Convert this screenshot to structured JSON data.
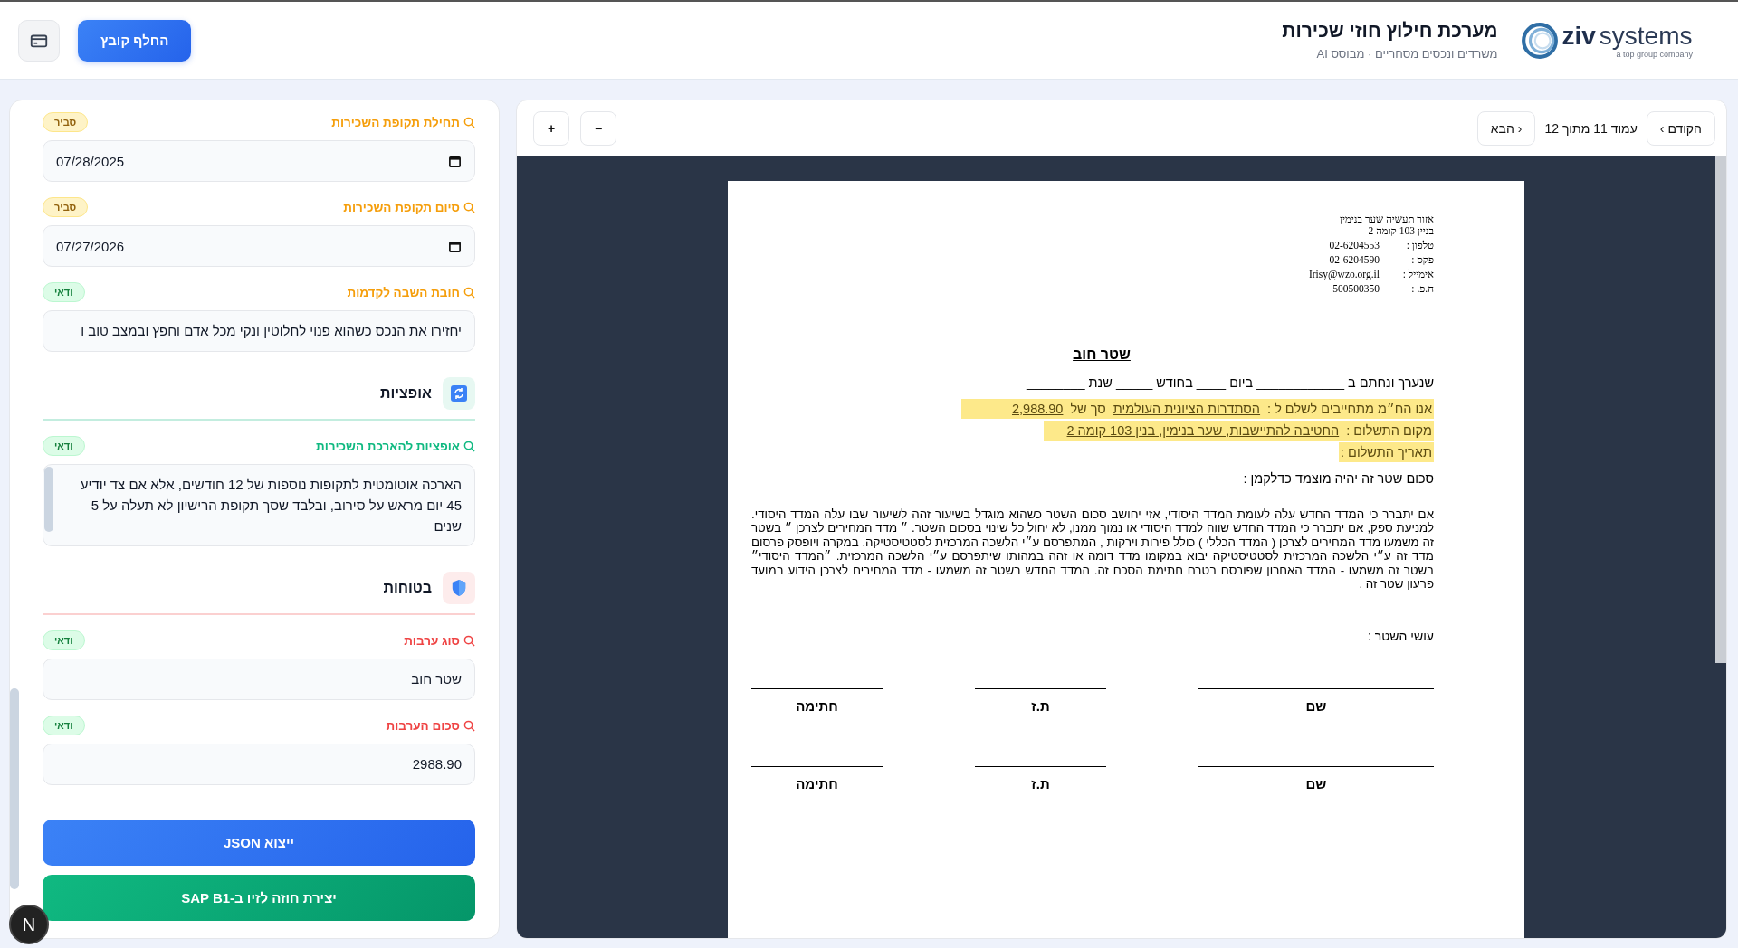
{
  "header": {
    "title": "מערכת חילוץ חוזי שכירות",
    "subtitle": "משרדים ונכסים מסחריים · מבוסס AI",
    "logo": {
      "word_bold": "ziv",
      "word": "systems",
      "tagline": "a top group company"
    },
    "replace_button": "החלף קובץ"
  },
  "form": {
    "sections": [
      {
        "color": "#f59e0b",
        "fields": [
          {
            "label": "תחילת תקופת השכירות",
            "badge": {
              "text": "סביר",
              "kind": "likely"
            },
            "kind": "date",
            "value": "07/28/2025"
          },
          {
            "label": "סיום תקופת השכירות",
            "badge": {
              "text": "סביר",
              "kind": "likely"
            },
            "kind": "date",
            "value": "07/27/2026"
          },
          {
            "label": "חובת השבה לקדמות",
            "badge": {
              "text": "ודאי",
              "kind": "certain"
            },
            "kind": "text",
            "value": "יחזירו את הנכס כשהוא פנוי לחלוטין ונקי מכל אדם וחפץ ובמצב טוב ו"
          }
        ]
      },
      {
        "title": "אופציות",
        "color": "#10b981",
        "fields": [
          {
            "label": "אופציות להארכת השכירות",
            "badge": {
              "text": "ודאי",
              "kind": "certain"
            },
            "kind": "textarea",
            "value": "הארכה אוטומטית לתקופות נוספות של 12 חודשים, אלא אם צד יודיע 45 יום מראש על סירוב, ובלבד שסך תקופת הרישיון לא תעלה על 5 שנים"
          }
        ]
      },
      {
        "title": "בטוחות",
        "color": "#ef4444",
        "fields": [
          {
            "label": "סוג ערבות",
            "badge": {
              "text": "ודאי",
              "kind": "certain"
            },
            "kind": "text",
            "value": "שטר חוב"
          },
          {
            "label": "סכום הערבות",
            "badge": {
              "text": "ודאי",
              "kind": "certain"
            },
            "kind": "text",
            "value": "2988.90"
          }
        ]
      }
    ],
    "export_button": "ייצוא JSON",
    "sap_button": "יצירת חוזה לזיו ב-SAP B1"
  },
  "dev_badge": "N",
  "viewer": {
    "prev": "‹ הקודם",
    "page_info": "עמוד 11 מתוך 12",
    "next": "הבא ›",
    "zoom_in": "+",
    "zoom_out": "−"
  },
  "document": {
    "address": [
      "אזור תעשיה שער בנימין",
      "בניין 103 קומה 2"
    ],
    "contacts": [
      {
        "label": "טלפון :",
        "value": "02-6204553"
      },
      {
        "label": "פקס :",
        "value": "02-6204590"
      },
      {
        "label": "אימייל :",
        "value": "Irisy@wzo.org.il"
      },
      {
        "label": "ח.פ. :",
        "value": "500500350"
      }
    ],
    "title": "שטר חוב",
    "signed_line": "שנערך ונחתם ב ____________ ביום ____ בחודש _____ שנת ________",
    "highlighted": [
      {
        "parts": [
          {
            "text": "אנו הח״מ מתחייבים לשלם ל :",
            "underline": false
          },
          {
            "text": "הסתדרות הציונית העולמית",
            "underline": true
          },
          {
            "text": "סך של",
            "underline": false
          },
          {
            "text": "2,988.90",
            "underline": true
          }
        ]
      },
      {
        "parts": [
          {
            "text": "מקום התשלום :",
            "underline": false
          },
          {
            "text": "החטיבה להתיישבות, שער בנימין, בנין 103 קומה 2",
            "underline": true
          }
        ]
      },
      {
        "parts": [
          {
            "text": "תאריך התשלום :",
            "underline": false
          }
        ]
      }
    ],
    "linked_line": "סכום שטר זה יהיה מוצמד כדלקמן :",
    "paragraph": "אם יתברר כי המדד החדש עלה לעומת המדד היסודי, אזי יחושב סכום השטר כשהוא מוגדל בשיעור זהה לשיעור שבו עלה המדד היסודי. למניעת ספק, אם יתברר כי המדד החדש שווה למדד היסודי או נמוך ממנו, לא יחול כל שינוי בסכום השטר. ״ מדד המחירים לצרכן ״ בשטר זה משמעו מדד המחירים לצרכן ( המדד הכללי ) כולל פירות וירקות , המתפרסם ע״י הלשכה המרכזית לסטטיסטיקה. במקרה ויופסק פרסום מדד זה ע״י הלשכה המרכזית לסטטיסטיקה יבוא במקומו מדד דומה או זהה במהותו שיתפרסם ע״י הלשכה המרכזית. ״המדד היסודי״ בשטר זה משמעו - המדד האחרון שפורסם בטרם חתימת הסכם זה. המדד החדש בשטר זה משמעו - מדד המחירים לצרכן הידוע במועד פרעון שטר זה .",
    "makers": "עושי השטר :",
    "signature_rows": [
      [
        "שם",
        "ת.ז",
        "חתימה"
      ],
      [
        "שם",
        "ת.ז",
        "חתימה"
      ]
    ]
  }
}
